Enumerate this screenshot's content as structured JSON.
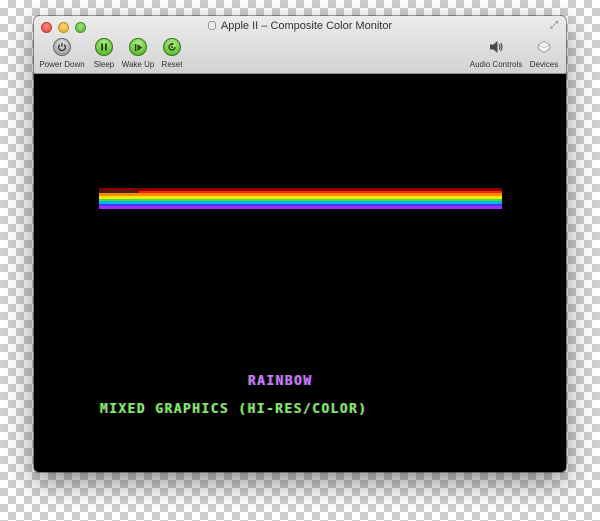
{
  "window": {
    "title": "Apple II – Composite Color Monitor"
  },
  "toolbar": {
    "power_down": {
      "label": "Power Down",
      "icon": "power-icon"
    },
    "sleep": {
      "label": "Sleep",
      "icon": "pause-icon"
    },
    "wake_up": {
      "label": "Wake Up",
      "icon": "play-icon"
    },
    "reset": {
      "label": "Reset",
      "icon": "reset-icon"
    },
    "audio_controls": {
      "label": "Audio Controls",
      "icon": "speaker-icon"
    },
    "devices": {
      "label": "Devices",
      "icon": "devices-icon"
    }
  },
  "screen": {
    "line1": "RAINBOW",
    "line2": "MIXED GRAPHICS (HI-RES/COLOR)"
  },
  "colors": {
    "rainbow_bands": [
      "#8a0000",
      "#ff2200",
      "#ff8a00",
      "#ffe600",
      "#47e02a",
      "#00b6ff",
      "#3b3bff",
      "#a02cff"
    ],
    "text_purple": "#c27cff",
    "text_green": "#78f25e"
  }
}
